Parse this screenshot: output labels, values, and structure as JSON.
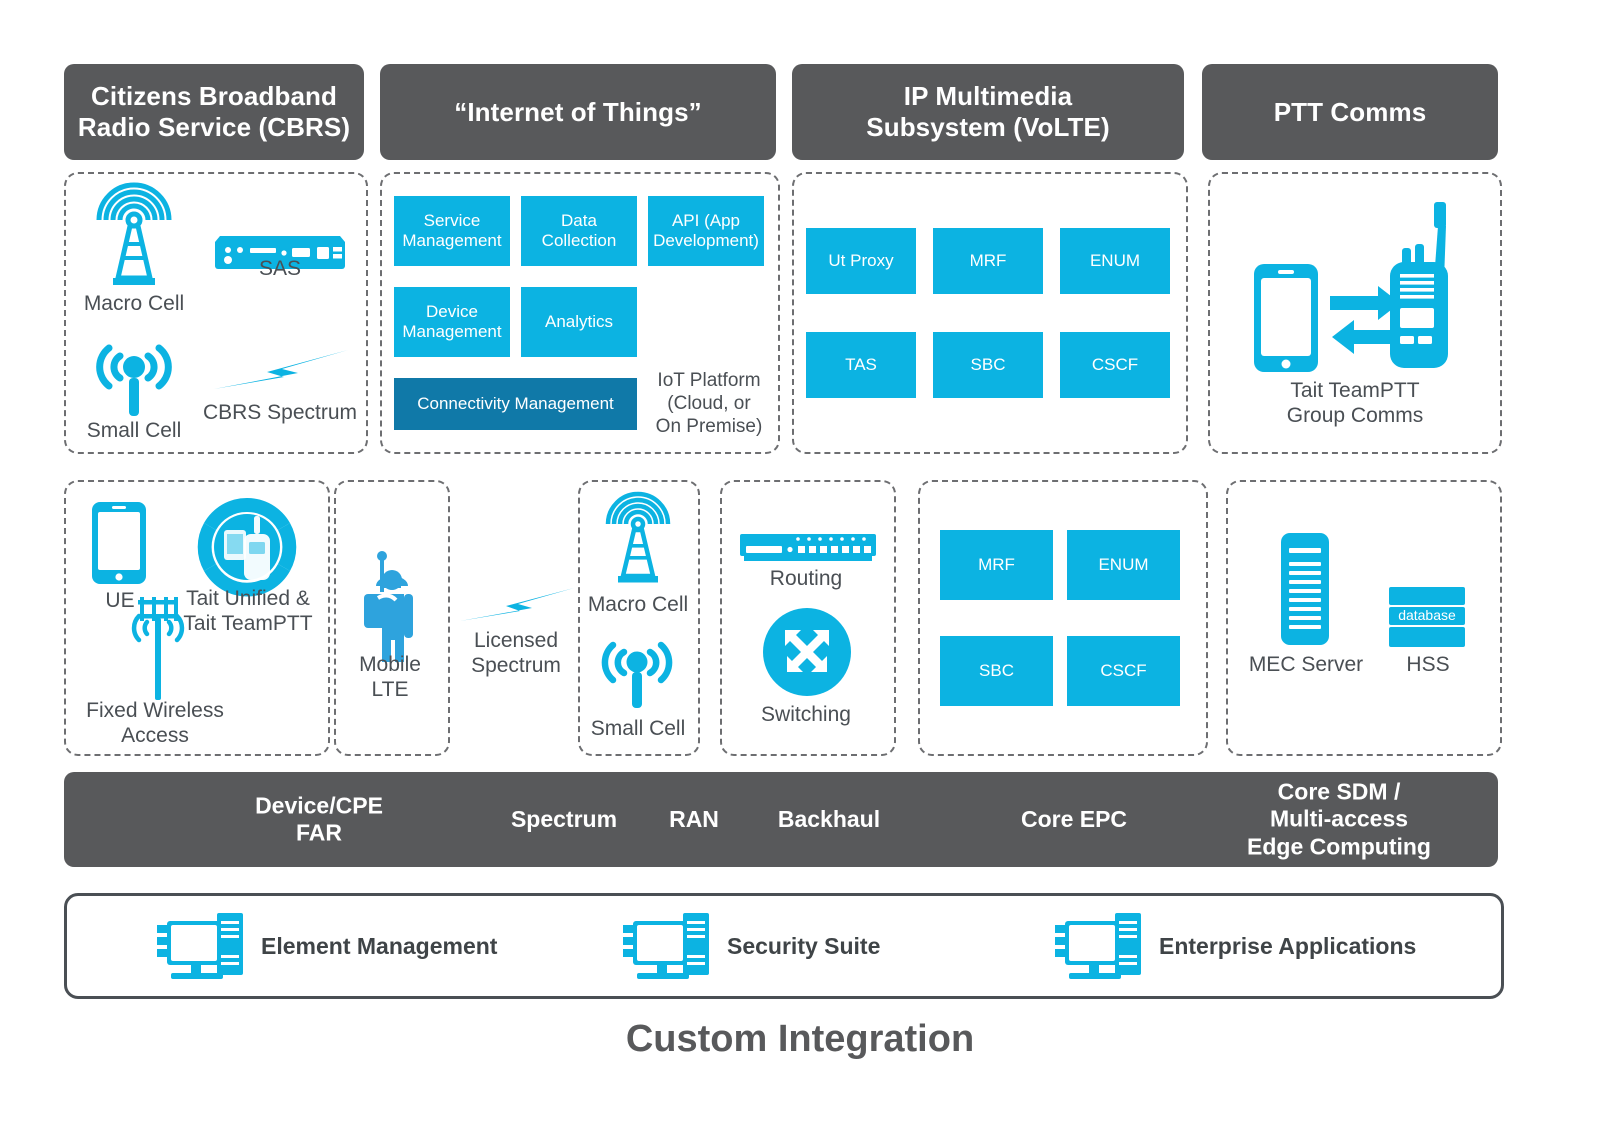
{
  "colors": {
    "header_gray": "#58595b",
    "accent_blue": "#0cb3e2",
    "dark_blue": "#1079a8",
    "text_gray": "#4a4f54"
  },
  "headers": [
    {
      "id": "cbrs",
      "label": "Citizens Broadband\nRadio Service (CBRS)"
    },
    {
      "id": "iot",
      "label": "“Internet of Things”"
    },
    {
      "id": "ims",
      "label": "IP Multimedia\nSubsystem (VoLTE)"
    },
    {
      "id": "ptt",
      "label": "PTT Comms"
    }
  ],
  "cbrs_panel": {
    "macro_cell": "Macro Cell",
    "sas": "SAS",
    "small_cell": "Small Cell",
    "cbrs_spectrum": "CBRS Spectrum"
  },
  "iot_panel": {
    "boxes": [
      {
        "label": "Service\nManagement",
        "tone": "light"
      },
      {
        "label": "Data\nCollection",
        "tone": "light"
      },
      {
        "label": "API (App\nDevelopment)",
        "tone": "light"
      },
      {
        "label": "Device\nManagement",
        "tone": "light"
      },
      {
        "label": "Analytics",
        "tone": "light"
      },
      {
        "label": "Connectivity Management",
        "tone": "dark"
      }
    ],
    "caption": "IoT Platform\n(Cloud, or\nOn Premise)"
  },
  "ims_panel": {
    "boxes": [
      "Ut Proxy",
      "MRF",
      "ENUM",
      "TAS",
      "SBC",
      "CSCF"
    ]
  },
  "ptt_panel": {
    "caption": "Tait TeamPTT\nGroup Comms"
  },
  "device_panel": {
    "ue": "UE",
    "tait": "Tait Unified &\nTait TeamPTT",
    "fwa": "Fixed Wireless\nAccess"
  },
  "mobile_panel": {
    "label": "Mobile\nLTE"
  },
  "spectrum_panel": {
    "label": "Licensed\nSpectrum"
  },
  "ran_panel": {
    "macro_cell": "Macro Cell",
    "small_cell": "Small Cell"
  },
  "backhaul_panel": {
    "routing": "Routing",
    "switching": "Switching"
  },
  "core_epc_panel": {
    "boxes": [
      "MRF",
      "ENUM",
      "SBC",
      "CSCF"
    ]
  },
  "edge_panel": {
    "mec": "MEC Server",
    "hss": "HSS",
    "db_tag": "database"
  },
  "band_labels": [
    {
      "id": "device-cpe-far",
      "label": "Device/CPE\nFAR"
    },
    {
      "id": "spectrum",
      "label": "Spectrum"
    },
    {
      "id": "ran",
      "label": "RAN"
    },
    {
      "id": "backhaul",
      "label": "Backhaul"
    },
    {
      "id": "core-epc",
      "label": "Core EPC"
    },
    {
      "id": "core-sdm-mec",
      "label": "Core SDM /\nMulti-access\nEdge Computing"
    }
  ],
  "services": [
    {
      "id": "element-management",
      "label": "Element Management"
    },
    {
      "id": "security-suite",
      "label": "Security Suite"
    },
    {
      "id": "enterprise-applications",
      "label": "Enterprise Applications"
    }
  ],
  "footer_title": "Custom Integration"
}
